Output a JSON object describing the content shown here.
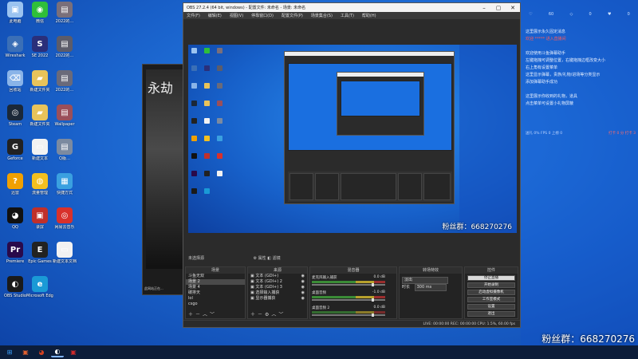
{
  "desktop": {
    "icons": [
      {
        "label": "此电脑",
        "color": "#9bc3f0",
        "glyph": "▣"
      },
      {
        "label": "微信",
        "color": "#2fbf3a",
        "glyph": "◉"
      },
      {
        "label": "2022的…",
        "color": "#7a6f7a",
        "glyph": "▤"
      },
      {
        "label": "Wireshark",
        "color": "#3b6fb6",
        "glyph": "◈"
      },
      {
        "label": "SE 2022",
        "color": "#2a2f7a",
        "glyph": "S"
      },
      {
        "label": "2022的…",
        "color": "#5c5c6a",
        "glyph": "▤"
      },
      {
        "label": "回收站",
        "color": "#8ab4e8",
        "glyph": "⌫"
      },
      {
        "label": "新建文件夹",
        "color": "#e8c35a",
        "glyph": "▰"
      },
      {
        "label": "2022的…",
        "color": "#6a6a7a",
        "glyph": "▤"
      },
      {
        "label": "Steam",
        "color": "#1b2838",
        "glyph": "◎"
      },
      {
        "label": "新建文件夹",
        "color": "#e8c35a",
        "glyph": "▰"
      },
      {
        "label": "Wallpaper",
        "color": "#9a4f5a",
        "glyph": "▤"
      },
      {
        "label": "Geforce",
        "color": "#222",
        "glyph": "G"
      },
      {
        "label": "新建文本",
        "color": "#f2f2f2",
        "glyph": "▭"
      },
      {
        "label": "Q版…",
        "color": "#7b8aa0",
        "glyph": "▤"
      },
      {
        "label": "迅雷",
        "color": "#f0a000",
        "glyph": "?"
      },
      {
        "label": "流量管理",
        "color": "#f2c020",
        "glyph": "◍"
      },
      {
        "label": "快捷方式",
        "color": "#3aa0e0",
        "glyph": "▦"
      },
      {
        "label": "QQ",
        "color": "#111",
        "glyph": "◕"
      },
      {
        "label": "录屏",
        "color": "#c0302a",
        "glyph": "▣"
      },
      {
        "label": "网易云音乐",
        "color": "#d8312b",
        "glyph": "◎"
      },
      {
        "label": "Premiere",
        "color": "#2a0a4a",
        "glyph": "Pr"
      },
      {
        "label": "Epic Games",
        "color": "#222",
        "glyph": "E"
      },
      {
        "label": "新建文本文档",
        "color": "#f2f2f2",
        "glyph": "▭"
      },
      {
        "label": "OBS Studio",
        "color": "#1a1a1a",
        "glyph": "◐"
      },
      {
        "label": "Microsoft Edge",
        "color": "#1a9ad6",
        "glyph": "e"
      }
    ],
    "watermark": "粉丝群：668270276"
  },
  "bg_window": {
    "art_title": "永劫",
    "status": "此网站正在..."
  },
  "obs": {
    "title": "OBS 27.2.4 (64 bit, windows) - 配置文件: 未命名 - 场景: 未命名",
    "menu": [
      "文件(F)",
      "编辑(E)",
      "视图(V)",
      "停靠窗口(D)",
      "配置文件(P)",
      "场景集合(S)",
      "工具(T)",
      "帮助(H)"
    ],
    "preview_watermark": "粉丝群：668270276",
    "scene_tab": "未选择源",
    "scene_tab_btns": "⚙ 属性   ◧ 滤镜",
    "panels": {
      "scenes": {
        "title": "场景",
        "items": [
          "斗鱼无双",
          "场景 2",
          "场景 4",
          "碳排天",
          "lol",
          "csgo"
        ],
        "selected": 1
      },
      "sources": {
        "title": "来源",
        "items": [
          "文本 (GDI+)",
          "文本 (GDI+) 2",
          "文本 (GDI+) 3",
          "选择输入捕获",
          "显示器捕获"
        ]
      },
      "mixer": {
        "title": "混音器",
        "channels": [
          {
            "name": "麦克风输入捕获",
            "db": "0.0 dB"
          },
          {
            "name": "桌面音频",
            "db": "-1.0 dB"
          },
          {
            "name": "桌面音频 2",
            "db": "0.0 dB"
          }
        ]
      },
      "transitions": {
        "title": "转场特效",
        "type": "淡出",
        "duration_label": "时长",
        "duration": "300 ms"
      },
      "controls": {
        "title": "控件",
        "buttons": [
          "停止直播",
          "开始录制",
          "启动虚拟摄像机",
          "工作室模式",
          "设置",
          "退出"
        ]
      }
    },
    "status": "LIVE: 00:00:00   REC: 00:00:00   CPU: 1.5%, 60.00 fps"
  },
  "chat": {
    "top": [
      "♡",
      "60",
      "◇",
      "0",
      "♥",
      "0"
    ],
    "lines": [
      {
        "text": "这里展示永久固定消息",
        "hl": false
      },
      {
        "text": "欢迎 ***** 进入直播间",
        "hl": true
      },
      {
        "text": "",
        "hl": false
      },
      {
        "text": "欢迎使用斗鱼弹幕助手",
        "hl": false
      },
      {
        "text": "左键拖拽可调整位置，右键拖拽边框改变大小",
        "hl": false
      },
      {
        "text": "右上角有设置菜单",
        "hl": false
      },
      {
        "text": "这里显示弹幕，贵族/礼物/进场等分类显示",
        "hl": false
      },
      {
        "text": "添加弹幕助手成功",
        "hl": false
      },
      {
        "text": "",
        "hl": false
      },
      {
        "text": "这里展示你收到的礼物，道具",
        "hl": false
      },
      {
        "text": "点击菜单可设置小礼物屏蔽",
        "hl": false
      }
    ],
    "stats_left": "送礼 0% FPS 0 上榜 0",
    "stats_right": "打卡 0 分 打卡 3"
  },
  "taskbar": {
    "items": [
      {
        "name": "windows-start-icon",
        "glyph": "⊞",
        "color": "#3aa0ff"
      },
      {
        "name": "app-icon-1",
        "glyph": "▣",
        "color": "#e06030"
      },
      {
        "name": "app-icon-2",
        "glyph": "◕",
        "color": "#d04020"
      },
      {
        "name": "obs-taskbar-icon",
        "glyph": "◐",
        "color": "#ffffff"
      },
      {
        "name": "app-icon-3",
        "glyph": "▣",
        "color": "#d02a2a"
      }
    ]
  }
}
